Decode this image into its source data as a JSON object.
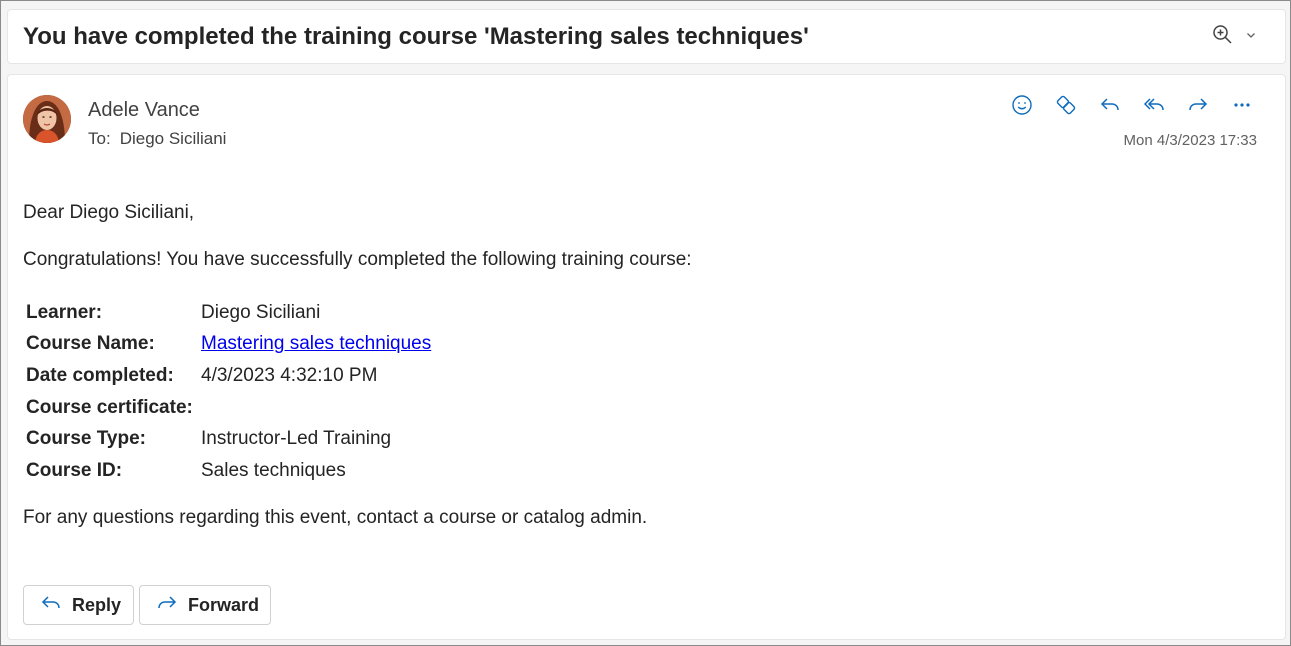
{
  "subject": "You have completed the training course 'Mastering sales techniques'",
  "header": {
    "sender": "Adele Vance",
    "to_label": "To:",
    "recipient": "Diego Siciliani",
    "date": "Mon 4/3/2023 17:33"
  },
  "icons": {
    "zoom": "zoom-in-icon",
    "chevron": "chevron-down-icon",
    "emoji": "emoji-icon",
    "loop": "loop-icon",
    "reply": "reply-icon",
    "reply_all": "reply-all-icon",
    "forward": "forward-icon",
    "more": "more-icon"
  },
  "colors": {
    "accent": "#0f6cbd",
    "link": "#0000ee"
  },
  "body": {
    "greeting": "Dear Diego Siciliani,",
    "intro": "Congratulations! You have successfully completed the following training course:",
    "details": [
      {
        "label": "Learner:",
        "value": "Diego Siciliani"
      },
      {
        "label": "Course Name:",
        "value": "Mastering sales techniques"
      },
      {
        "label": "Date completed:",
        "value": "4/3/2023 4:32:10 PM"
      },
      {
        "label": "Course certificate:",
        "value": ""
      },
      {
        "label": "Course Type:",
        "value": "Instructor-Led Training"
      },
      {
        "label": "Course ID:",
        "value": "Sales techniques"
      }
    ],
    "footer": "For any questions regarding this event, contact a course or catalog admin."
  },
  "buttons": {
    "reply": "Reply",
    "forward": "Forward"
  }
}
